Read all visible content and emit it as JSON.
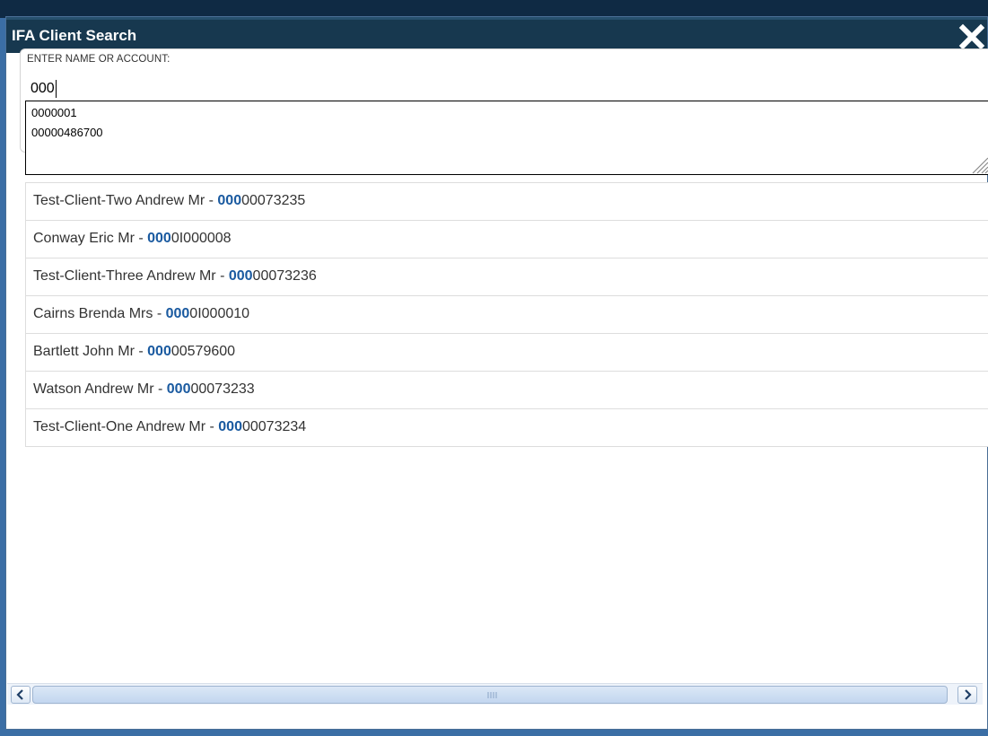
{
  "dialog": {
    "title": "IFA Client Search",
    "close_icon": "close-x-icon"
  },
  "search": {
    "label": "ENTER NAME OR ACCOUNT:",
    "value": "000",
    "suggestions": [
      "0000001",
      "00000486700"
    ]
  },
  "results": [
    {
      "name": "Test-Client-Two Andrew Mr - ",
      "match": "000",
      "rest": "00073235"
    },
    {
      "name": "Conway Eric Mr - ",
      "match": "000",
      "rest": "0I000008"
    },
    {
      "name": "Test-Client-Three Andrew Mr - ",
      "match": "000",
      "rest": "00073236"
    },
    {
      "name": "Cairns Brenda Mrs - ",
      "match": "000",
      "rest": "0I000010"
    },
    {
      "name": "Bartlett John Mr - ",
      "match": "000",
      "rest": "00579600"
    },
    {
      "name": "Watson Andrew Mr - ",
      "match": "000",
      "rest": "00073233"
    },
    {
      "name": "Test-Client-One Andrew Mr - ",
      "match": "000",
      "rest": "00073234"
    }
  ],
  "scrollbar": {
    "left_icon": "chevron-left-icon",
    "right_icon": "chevron-right-icon"
  },
  "colors": {
    "title_bar": "#17384f",
    "match_highlight": "#1a5aa0"
  }
}
